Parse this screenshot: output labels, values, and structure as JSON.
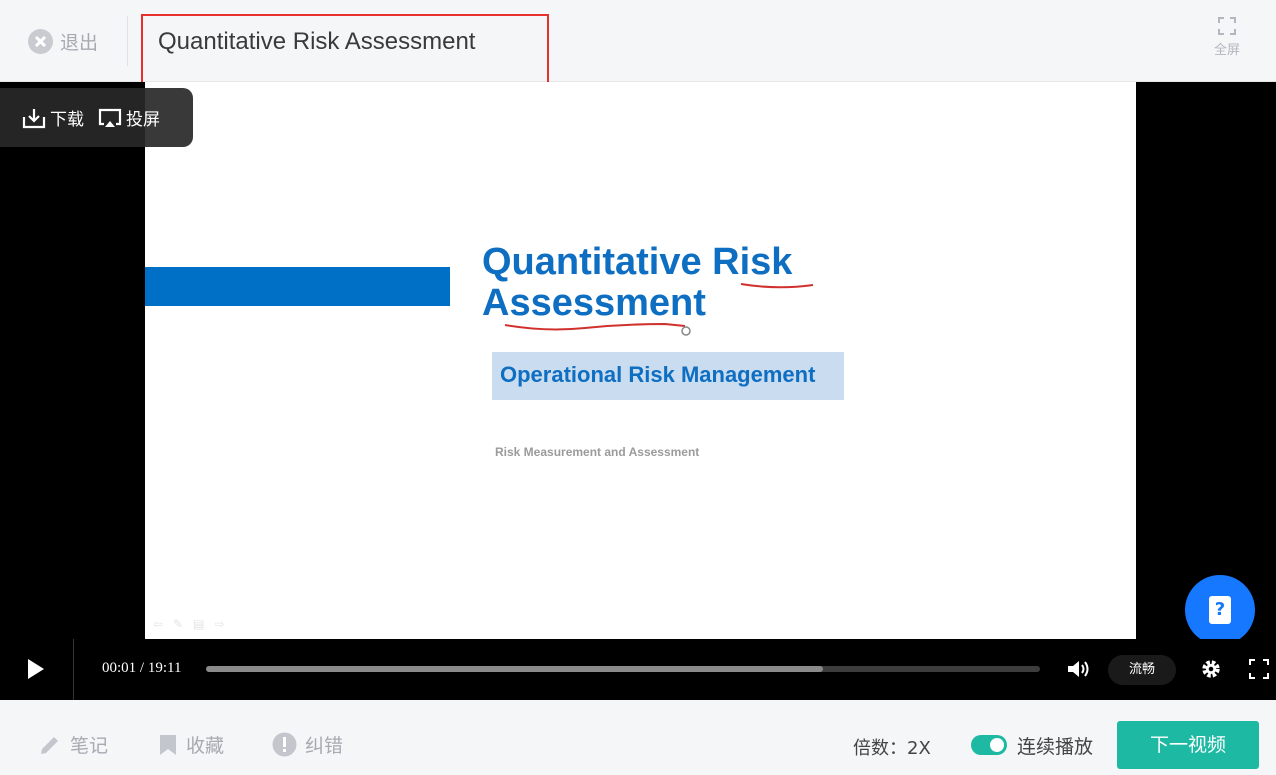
{
  "header": {
    "exit_label": "退出",
    "title": "Quantitative Risk Assessment",
    "fullscreen_label": "全屏"
  },
  "player": {
    "actions": {
      "download_label": "下载",
      "cast_label": "投屏"
    },
    "slide": {
      "title_line1": "Quantitative Risk",
      "title_line2": "Assessment",
      "subtitle": "Operational Risk Management",
      "small_text": "Risk Measurement and Assessment"
    },
    "controls": {
      "time": "00:01 / 19:11",
      "buffered_fraction": 0.74,
      "quality_label": "流畅"
    }
  },
  "bottom": {
    "notes_label": "笔记",
    "favorite_label": "收藏",
    "report_error_label": "纠错",
    "speed_text": "倍数：2X",
    "autoplay_label": "连续播放",
    "autoplay_on": true,
    "next_label": "下一视频"
  },
  "colors": {
    "accent": "#1db9a3",
    "help": "#1677ff",
    "highlight_border": "#e8302d",
    "slide_blue": "#0e6ec2"
  },
  "icons": [
    "close-circle-icon",
    "fullscreen-icon",
    "download-icon",
    "cast-icon",
    "help-icon",
    "play-icon",
    "volume-icon",
    "gear-icon",
    "pencil-icon",
    "bookmark-icon",
    "alert-icon"
  ]
}
